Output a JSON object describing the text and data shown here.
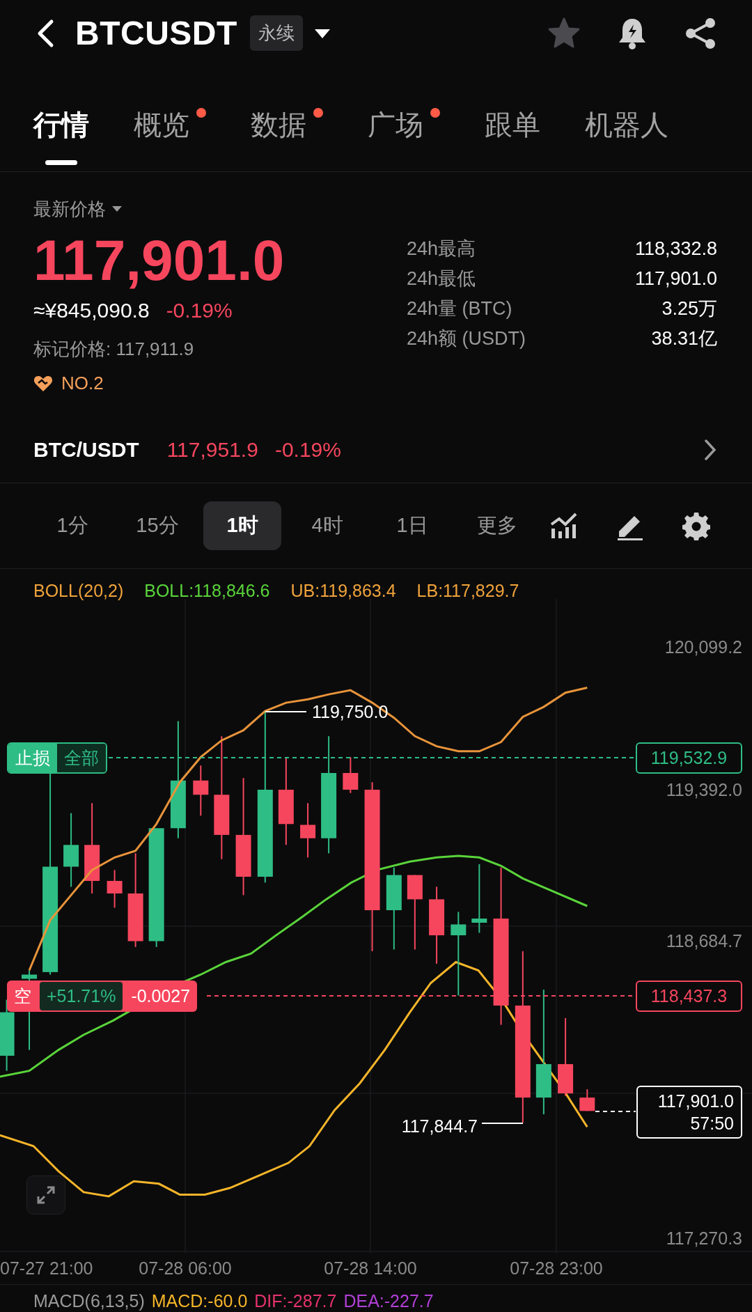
{
  "header": {
    "title": "BTCUSDT",
    "badge": "永续"
  },
  "tabs": [
    {
      "label": "行情",
      "selected": true,
      "dot": false
    },
    {
      "label": "概览",
      "selected": false,
      "dot": true
    },
    {
      "label": "数据",
      "selected": false,
      "dot": true
    },
    {
      "label": "广场",
      "selected": false,
      "dot": true
    },
    {
      "label": "跟单",
      "selected": false,
      "dot": false
    },
    {
      "label": "机器人",
      "selected": false,
      "dot": false
    }
  ],
  "price": {
    "label": "最新价格",
    "last": "117,901.0",
    "cny": "≈¥845,090.8",
    "change": "-0.19%",
    "mark": "标记价格: 117,911.9",
    "rank": "NO.2"
  },
  "stats": [
    {
      "label": "24h最高",
      "value": "118,332.8"
    },
    {
      "label": "24h最低",
      "value": "117,901.0"
    },
    {
      "label": "24h量 (BTC)",
      "value": "3.25万"
    },
    {
      "label": "24h额 (USDT)",
      "value": "38.31亿"
    }
  ],
  "spot": {
    "pair": "BTC/USDT",
    "price": "117,951.9",
    "change": "-0.19%"
  },
  "intervals": [
    {
      "label": "1分",
      "selected": false
    },
    {
      "label": "15分",
      "selected": false
    },
    {
      "label": "1时",
      "selected": true
    },
    {
      "label": "4时",
      "selected": false
    },
    {
      "label": "1日",
      "selected": false
    },
    {
      "label": "更多",
      "selected": false
    }
  ],
  "indicator": {
    "name": "BOLL(20,2)",
    "boll": "BOLL:118,846.6",
    "ub": "UB:119,863.4",
    "lb": "LB:117,829.7"
  },
  "chart": {
    "y_axis_labels": [
      "120,099.2",
      "119,392.0",
      "118,684.7",
      "117,270.3"
    ],
    "x_axis_labels": [
      "07-27 21:00",
      "07-28 06:00",
      "07-28 14:00",
      "07-28 23:00"
    ],
    "high_marker": "119,750.0",
    "low_marker": "117,844.7",
    "stop_loss": {
      "label": "止损",
      "scope": "全部",
      "price": "119,532.9"
    },
    "position": {
      "side": "空",
      "pnl": "+51.71%",
      "size": "-0.0027",
      "price": "118,437.3"
    },
    "current": {
      "price": "117,901.0",
      "countdown": "57:50"
    }
  },
  "macd": {
    "name": "MACD(6,13,5)",
    "macd": "MACD:-60.0",
    "dif": "DIF:-287.7",
    "dea": "DEA:-227.7"
  }
}
